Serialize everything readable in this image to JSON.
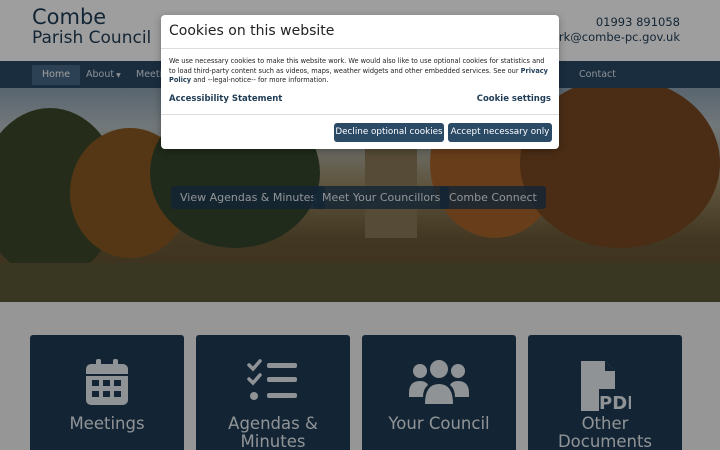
{
  "site": {
    "name_line1": "Combe",
    "name_line2": "Parish Council",
    "phone": "01993 891058",
    "email": "clerk@combe-pc.gov.uk"
  },
  "nav": {
    "items": [
      "Home",
      "About",
      "Meetings",
      "Contact"
    ]
  },
  "hero": {
    "buttons": [
      "View Agendas & Minutes",
      "Meet Your Councillors",
      "Combe Connect"
    ]
  },
  "cards": [
    {
      "label": "Meetings",
      "icon": "calendar-icon"
    },
    {
      "label": "Agendas &\nMinutes",
      "icon": "checklist-icon"
    },
    {
      "label": "Your Council",
      "icon": "people-icon"
    },
    {
      "label": "Other\nDocuments",
      "icon": "pdf-file-icon"
    }
  ],
  "cookie_modal": {
    "title": "Cookies on this website",
    "body_before_link": "We use necessary cookies to make this website work. We would also like to use optional cookies for statistics and to load third-party content such as videos, maps, weather widgets and other embedded services. See our ",
    "privacy_link": "Privacy Policy",
    "body_after_link": " and --legal-notice-- for more information.",
    "accessibility_link": "Accessibility Statement",
    "settings_link": "Cookie settings",
    "decline_button": "Decline optional cookies",
    "accept_button": "Accept necessary only"
  },
  "colors": {
    "brand_dark": "#1f3c55",
    "nav_bg": "#2a4a66"
  }
}
